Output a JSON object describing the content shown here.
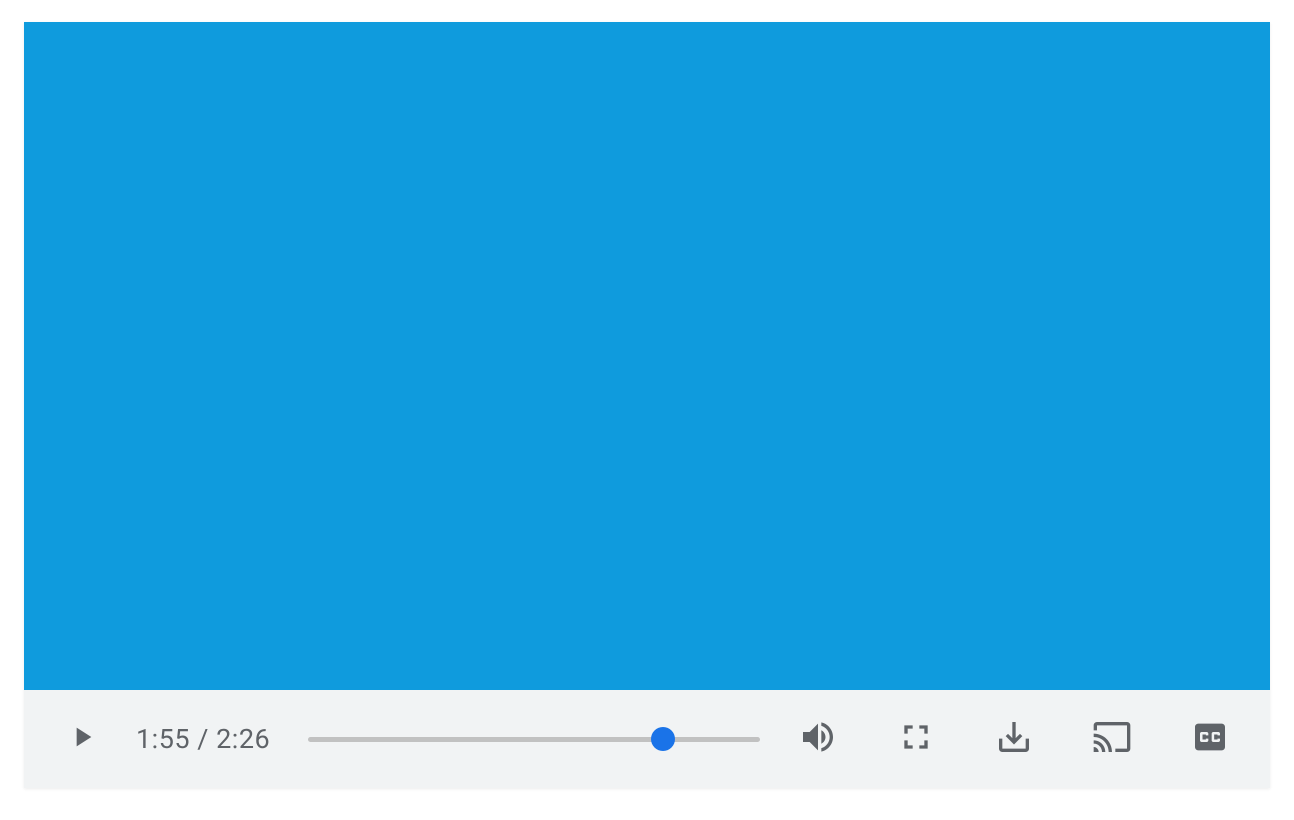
{
  "player": {
    "current_time": "1:55",
    "duration": "2:26",
    "separator": " / ",
    "progress_percent": 78.5,
    "colors": {
      "video_bg": "#0F9BDD",
      "controls_bg": "#F1F3F4",
      "icon": "#5F6368",
      "time_text": "#5F6368",
      "track": "#C1C1C1",
      "thumb": "#1A73E8"
    },
    "icons": {
      "play": "play-icon",
      "volume": "volume-icon",
      "fullscreen": "fullscreen-icon",
      "download": "download-icon",
      "cast": "cast-icon",
      "captions": "captions-icon"
    }
  }
}
